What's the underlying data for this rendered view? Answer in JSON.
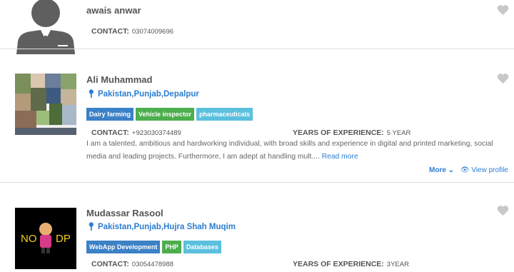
{
  "profiles": [
    {
      "name": "awais anwar",
      "contact_label": "CONTACT:",
      "contact": "03074009696"
    },
    {
      "name": "Ali Muhammad",
      "location": "Pakistan,Punjab,Depalpur",
      "tags": [
        {
          "label": "Dairy farming",
          "color": "#3b81c6"
        },
        {
          "label": "Vehicle inspector",
          "color": "#4cae4c"
        },
        {
          "label": "pharmaceuticals",
          "color": "#5bc0de"
        }
      ],
      "contact_label": "CONTACT:",
      "contact": "+923030374489",
      "experience_label": "YEARS OF EXPERIENCE:",
      "experience": "5 YEAR",
      "description": "I am a talented, ambitious and hardworking individual, with broad skills and experience in digital and printed marketing, social media and leading projects. Furthermore, I am adept at handling mult....",
      "read_more": "Read more",
      "more": "More",
      "view_profile": "View profile"
    },
    {
      "name": "Mudassar Rasool",
      "location": "Pakistan,Punjab,Hujra Shah Muqim",
      "tags": [
        {
          "label": "WebApp Development",
          "color": "#3b81c6"
        },
        {
          "label": "PHP",
          "color": "#4cae4c"
        },
        {
          "label": "Databases",
          "color": "#5bc0de"
        }
      ],
      "contact_label": "CONTACT:",
      "contact": "03054478988",
      "experience_label": "YEARS OF EXPERIENCE:",
      "experience": "3YEAR",
      "avatar_text_left": "NO",
      "avatar_text_right": "DP"
    }
  ],
  "colors": {
    "link": "#2b7dd0",
    "heart": "#c8c8c8",
    "divider": "#dddddd"
  }
}
